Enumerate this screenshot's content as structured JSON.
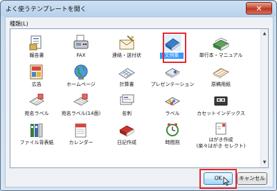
{
  "window": {
    "title": "よく使うテンプレートを開く",
    "close_symbol": "✕"
  },
  "group_label": "種類(L)",
  "items": [
    {
      "label": "報告書",
      "icon": "report-icon"
    },
    {
      "label": "FAX",
      "icon": "fax-icon"
    },
    {
      "label": "連絡・送付状",
      "icon": "cover-letter-icon"
    },
    {
      "label": "文例集",
      "icon": "sample-documents-icon",
      "selected": true
    },
    {
      "label": "単行本・マニュアル",
      "icon": "manual-icon"
    },
    {
      "label": "広告",
      "icon": "advertisement-icon"
    },
    {
      "label": "ホームページ",
      "icon": "globe-icon"
    },
    {
      "label": "計算書",
      "icon": "calculator-sheet-icon"
    },
    {
      "label": "プレゼンテーション",
      "icon": "projector-icon"
    },
    {
      "label": "原稿用紙",
      "icon": "manuscript-paper-icon"
    },
    {
      "label": "宛名ラベル",
      "icon": "address-label-icon"
    },
    {
      "label": "宛名ラベル(14面)",
      "icon": "address-label-14-icon"
    },
    {
      "label": "名刺",
      "icon": "business-card-icon"
    },
    {
      "label": "ラベル",
      "icon": "label-roll-icon"
    },
    {
      "label": "カセットインデックス",
      "icon": "cassette-icon"
    },
    {
      "label": "ファイル背表紙",
      "icon": "file-spine-icon"
    },
    {
      "label": "カレンダー",
      "icon": "calendar-icon"
    },
    {
      "label": "日記作成",
      "icon": "diary-icon"
    },
    {
      "label": "時間割",
      "icon": "clock-icon"
    },
    {
      "label": "はがき作成\n(楽々はがき セレクト)",
      "label_line1": "はがき作成",
      "label_line2": "(楽々はがき セレクト)",
      "icon": "postcard-icon"
    }
  ],
  "buttons": {
    "ok": "OK",
    "cancel": "キャンセル"
  },
  "colors": {
    "selection": "#3399ff",
    "highlight": "#e8242c"
  }
}
